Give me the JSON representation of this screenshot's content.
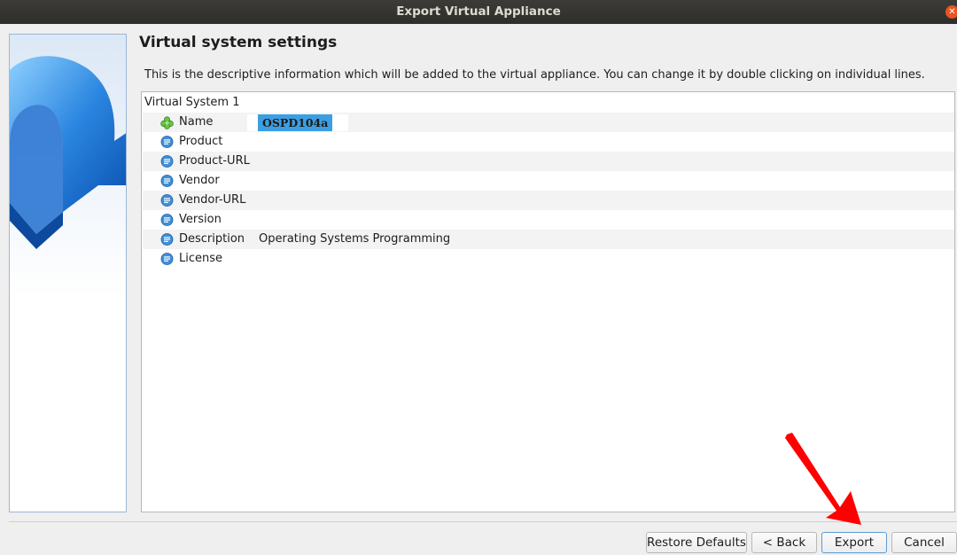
{
  "window": {
    "title": "Export Virtual Appliance",
    "close_icon": "close-icon"
  },
  "page": {
    "title": "Virtual system settings",
    "description": "This is the descriptive information which will be added to the virtual appliance. You can change it by double clicking on individual lines."
  },
  "tree": {
    "root_label": "Virtual System 1",
    "rows": [
      {
        "label": "Name",
        "value": "OSPD104a",
        "icon": "name-icon",
        "editing": true
      },
      {
        "label": "Product",
        "value": "",
        "icon": "description-icon"
      },
      {
        "label": "Product-URL",
        "value": "",
        "icon": "description-icon"
      },
      {
        "label": "Vendor",
        "value": "",
        "icon": "description-icon"
      },
      {
        "label": "Vendor-URL",
        "value": "",
        "icon": "description-icon"
      },
      {
        "label": "Version",
        "value": "",
        "icon": "description-icon"
      },
      {
        "label": "Description",
        "value": "Operating Systems Programming",
        "icon": "description-icon"
      },
      {
        "label": "License",
        "value": "",
        "icon": "description-icon"
      }
    ]
  },
  "buttons": {
    "restore_defaults": "Restore Defaults",
    "back": "< Back",
    "export": "Export",
    "cancel": "Cancel"
  },
  "colors": {
    "accent": "#3d9ee2",
    "titlebar": "#3c3b37",
    "close": "#e95420",
    "annotation_arrow": "#ff0000"
  }
}
